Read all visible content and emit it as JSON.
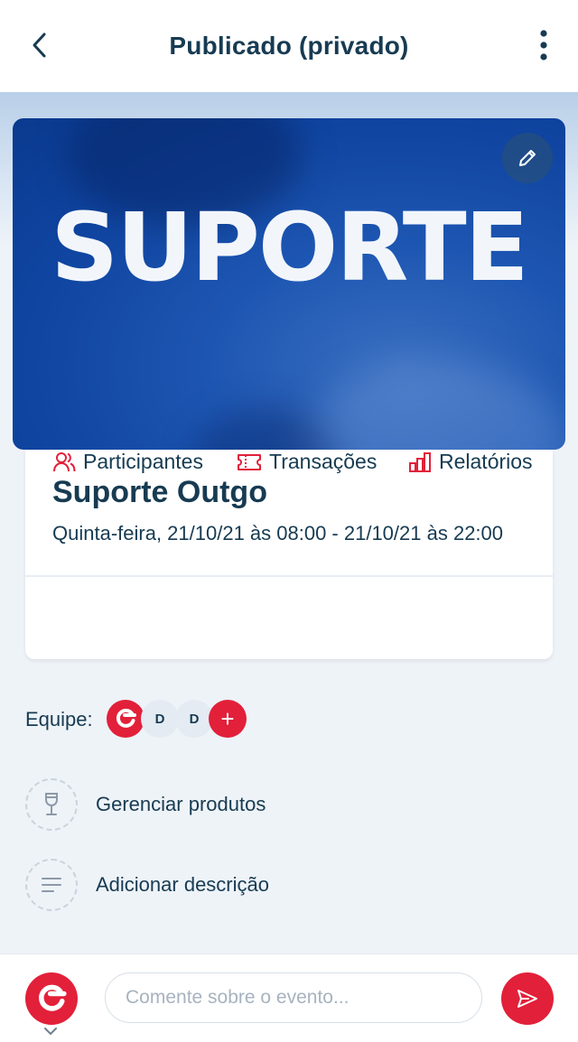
{
  "header": {
    "title": "Publicado (privado)",
    "back_icon": "chevron-left-icon",
    "more_icon": "more-vertical-icon"
  },
  "banner": {
    "text": "SUPORTE",
    "edit_icon": "pencil-icon"
  },
  "event": {
    "name": "Suporte Outgo",
    "date": "Quinta-feira, 21/10/21 às 08:00 - 21/10/21 às 22:00"
  },
  "actions": [
    {
      "label": "Participantes",
      "icon": "users-icon"
    },
    {
      "label": "Transações",
      "icon": "ticket-icon"
    },
    {
      "label": "Relatórios",
      "icon": "bar-chart-icon"
    }
  ],
  "team": {
    "label": "Equipe:",
    "members": [
      "D",
      "D"
    ],
    "add_label": "+"
  },
  "menu": [
    {
      "label": "Gerenciar produtos",
      "icon": "wine-glass-icon"
    },
    {
      "label": "Adicionar descrição",
      "icon": "text-lines-icon"
    }
  ],
  "comment": {
    "placeholder": "Comente sobre o evento...",
    "send_icon": "send-icon"
  },
  "colors": {
    "brand_red": "#e2203a",
    "text_dark": "#173b52",
    "banner_blue": "#1d56b2"
  }
}
